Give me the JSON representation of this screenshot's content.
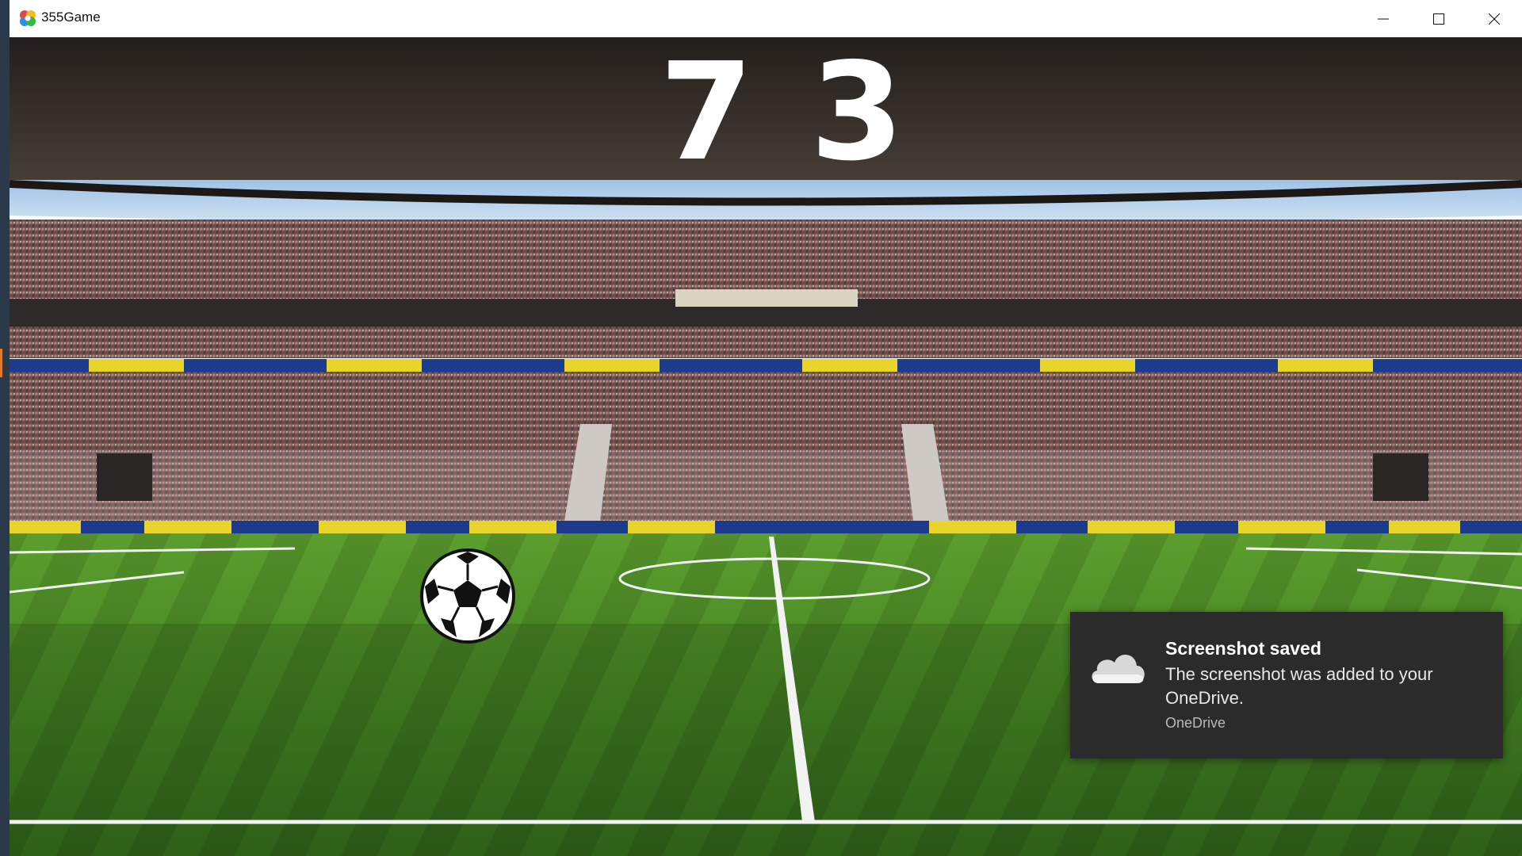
{
  "window": {
    "title": "355Game",
    "app_icon": "colorful-pinwheel-icon",
    "controls": [
      "minimize-icon",
      "maximize-icon",
      "close-icon"
    ]
  },
  "game": {
    "score_left": "7",
    "score_right": "3",
    "ball_icon": "soccer-ball-icon",
    "background": "stadium-with-crowd-and-pitch"
  },
  "toast": {
    "title": "Screenshot saved",
    "body": "The screenshot was added to your OneDrive.",
    "source": "OneDrive",
    "icon": "onedrive-cloud-icon",
    "background_color": "#2b2b2b"
  },
  "colors": {
    "pitch_green": "#4f8f2c",
    "roof_dark": "#2f2a26",
    "banner_yellow": "#e8d42a",
    "banner_blue": "#1d3b8c"
  }
}
